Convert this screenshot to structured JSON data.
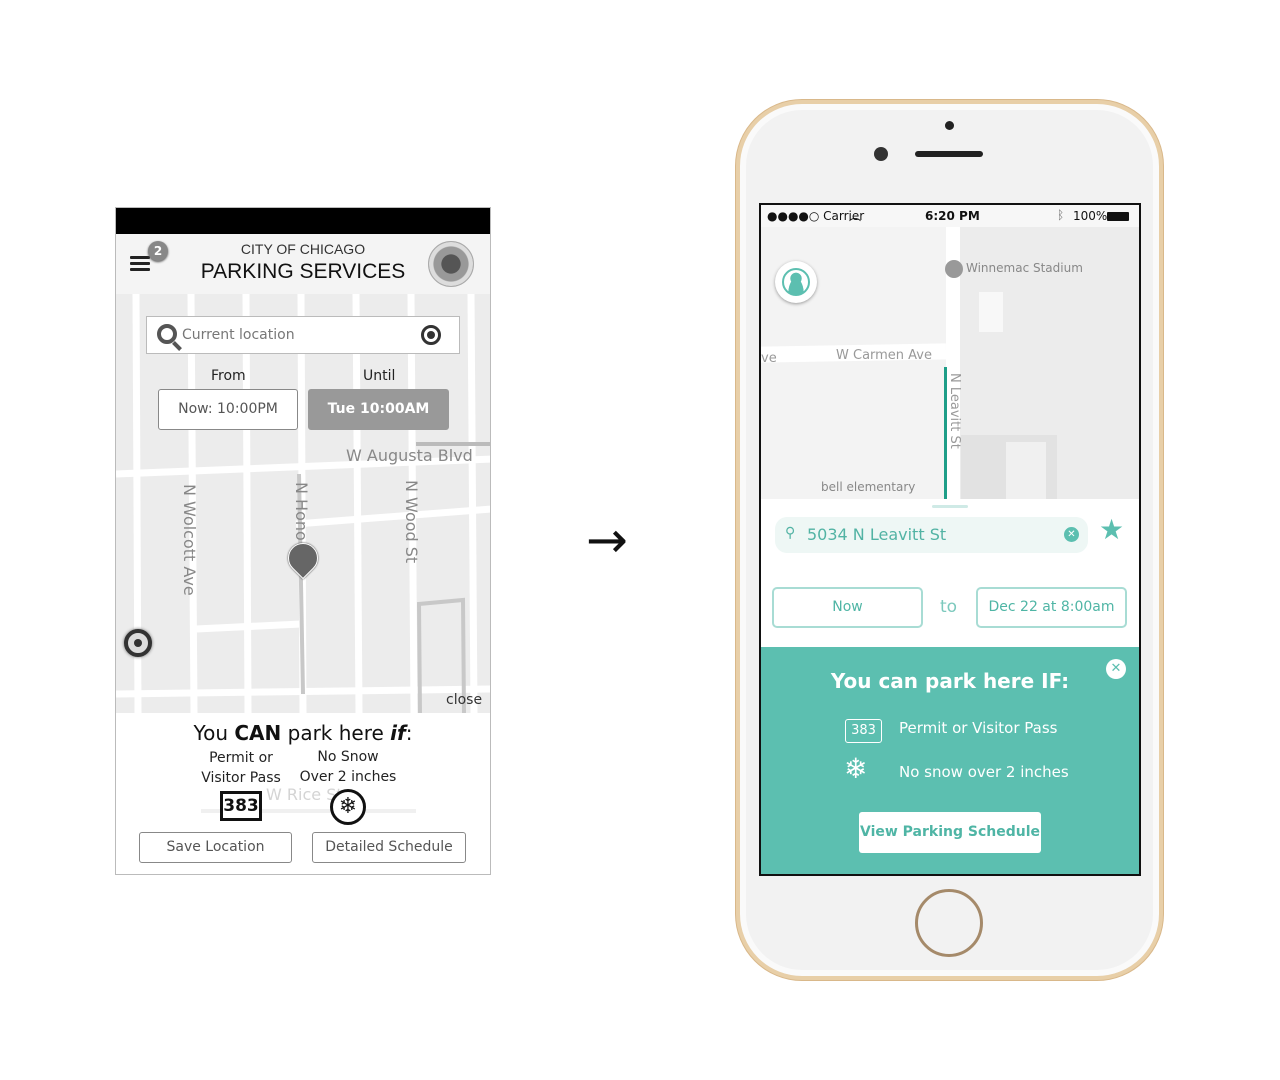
{
  "wireframe": {
    "header": {
      "line1": "CITY OF CHICAGO",
      "line2": "PARKING SERVICES",
      "notification_count": "2"
    },
    "search": {
      "placeholder": "Current location"
    },
    "from": {
      "label": "From",
      "value": "Now: 10:00PM"
    },
    "until": {
      "label": "Until",
      "value": "Tue 10:00AM"
    },
    "streets": {
      "augusta": "W Augusta Blvd",
      "wolcott": "N Wolcott Ave",
      "honore": "N Hono",
      "wood": "N Wood St",
      "rice": "W Rice St"
    },
    "close": "close",
    "result": {
      "you": "You ",
      "can": "CAN",
      "park": " park here ",
      "if": "if",
      "permit": "Permit or",
      "permit2": "Visitor Pass",
      "snow": "No Snow",
      "snow2": "Over 2 inches",
      "permit_no": "383"
    },
    "buttons": {
      "save": "Save Location",
      "schedule": "Detailed Schedule"
    }
  },
  "arrow": "→",
  "phone": {
    "status": {
      "carrier": "●●●●○ Carrier",
      "time": "6:20 PM",
      "battery": "100%"
    },
    "map": {
      "stadium": "Winnemac Stadium",
      "carmen": "W Carmen Ave",
      "ave_fragment": "ve",
      "leavitt": "N Leavitt St",
      "school": "bell elementary"
    },
    "search": {
      "value": "5034 N Leavitt St"
    },
    "time": {
      "from": "Now",
      "to": "to",
      "until": "Dec 22 at 8:00am"
    },
    "result": {
      "title": "You can park here IF:",
      "permit_no": "383",
      "permit": "Permit or Visitor Pass",
      "snow": "No snow over 2 inches",
      "button": "View Parking Schedule"
    },
    "colors": {
      "accent": "#5cbfb0"
    }
  }
}
